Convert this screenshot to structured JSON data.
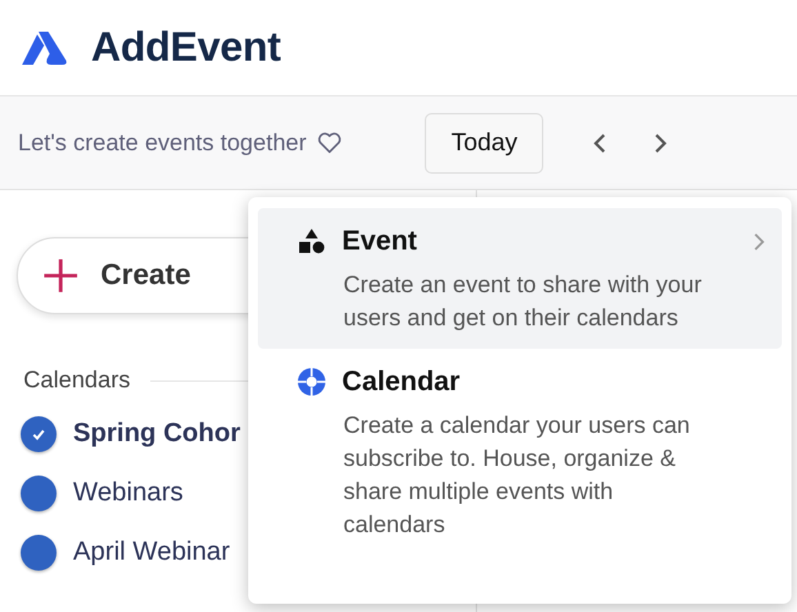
{
  "brand": {
    "name": "AddEvent"
  },
  "toolbar": {
    "tagline": "Let's create events together",
    "today_button": "Today"
  },
  "sidebar": {
    "create_button": "Create",
    "calendars_heading": "Calendars",
    "calendars": [
      {
        "name": "Spring Cohor",
        "checked": true,
        "color": "#2f62c0"
      },
      {
        "name": "Webinars",
        "checked": false,
        "color": "#2f62c0"
      },
      {
        "name": "April Webinar",
        "checked": false,
        "color": "#2f62c0"
      }
    ]
  },
  "create_menu": {
    "items": [
      {
        "kind": "event",
        "title": "Event",
        "description": "Create an event to share with your users and get on their calendars",
        "selected": true
      },
      {
        "kind": "calendar",
        "title": "Calendar",
        "description": "Create a calendar your users can subscribe to. House, organize & share multiple events with calendars",
        "selected": false
      }
    ]
  }
}
